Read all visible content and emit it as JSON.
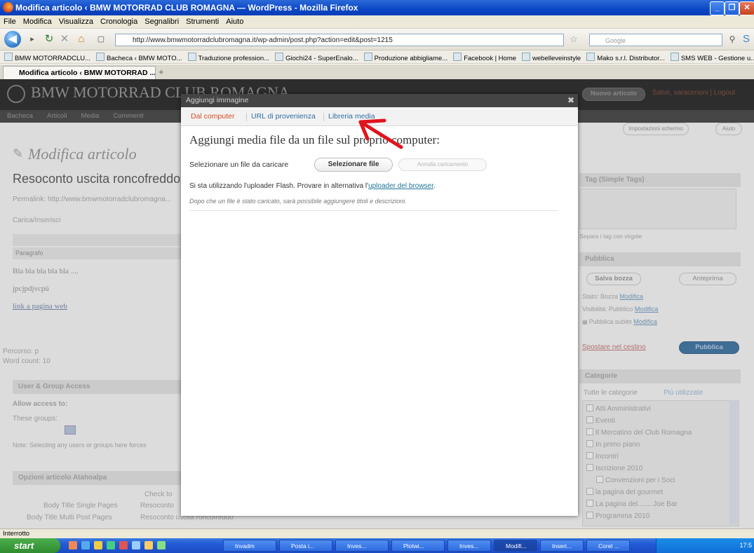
{
  "window": {
    "title": "Modifica articolo ‹ BMW MOTORRAD CLUB ROMAGNA — WordPress - Mozilla Firefox"
  },
  "menu": [
    "File",
    "Modifica",
    "Visualizza",
    "Cronologia",
    "Segnalibri",
    "Strumenti",
    "Aiuto"
  ],
  "nav": {
    "url": "http://www.bmwmotorradclubromagna.it/wp-admin/post.php?action=edit&post=1215",
    "search_placeholder": "Google"
  },
  "bookmarks": [
    "BMW MOTORRADCLU...",
    "Bacheca ‹ BMW MOTO...",
    "Traduzione profession...",
    "Giochi24 - SuperEnalo...",
    "Produzione abbigliame...",
    "Facebook | Home",
    "webelleveinstyle",
    "Mako s.r.l. Distributor...",
    "SMS WEB - Gestione u..."
  ],
  "tab": {
    "label": "Modifica articolo ‹ BMW MOTORRAD ..."
  },
  "wp": {
    "site_name": "BMW MOTORRAD CLUB ROMAGNA",
    "admin_menu": [
      "Bacheca",
      "Articoli",
      "Media",
      "Commenti"
    ],
    "new_post_btn": "Nuovo articolo",
    "howdy": "Salve, saracenoni | Logout",
    "screen_options": "Impostazioni schermo",
    "help": "Aiuto",
    "page_title": "Modifica articolo",
    "post_title": "Resoconto uscita roncofreddo",
    "permalink": "Permalink: http://www.bmwmotorradclubromagna...",
    "upload_insert": "Carica/Inserisci",
    "paragraph": "Paragrafo",
    "content_lines": [
      "Bla bla bla bla bla ....",
      "jpcjpdjvcpù",
      "link a pagina web"
    ],
    "path": "Percorso: p",
    "word_count": "Word count: 10",
    "user_group_access": "User & Group Access",
    "allow_access": "Allow access to:",
    "these_groups": "These groups:",
    "note": "Note: Selecting any users or groups here forces",
    "atahoalpa": "Opzioni articolo Atahoalpa",
    "check_to": "Check to",
    "body_title_single": "Body Title Single Pages",
    "body_title_multi": "Body Title Multi Post Pages",
    "resoconto": "Resoconto",
    "resoconto_multi": "Resoconto uscita roncofreddo",
    "tag_box": "Tag (Simple Tags)",
    "tag_hint": "Separa i tag con virgole",
    "publish_box": "Pubblica",
    "save_draft": "Salva bozza",
    "preview": "Anteprima",
    "status": "Stato: Bozza",
    "visibility": "Visibilità: Pubblico",
    "publish_now": "Pubblica subito",
    "edit_link": "Modifica",
    "trash": "Spostare nel cestino",
    "publish_btn": "Pubblica",
    "categories_box": "Categorie",
    "cat_tabs": [
      "Tutte le categorie",
      "Più utilizzate"
    ],
    "categories": [
      "Atti Amministrativi",
      "Eventi",
      "Il Mercatino del Club Romagna",
      "In primo piano",
      "Incontri",
      "Iscrizione 2010",
      "Convenzioni per i Soci",
      "la pagina del gourmet",
      "La pagina del....... Joe Bar",
      "Programma 2010"
    ]
  },
  "modal": {
    "title": "Aggiungi immagine",
    "tabs": [
      "Dal computer",
      "URL di provenienza",
      "Libreria media"
    ],
    "heading": "Aggiungi media file da un file sul proprio computer:",
    "select_label": "Selezionare un file da caricare",
    "select_btn": "Selezionare file",
    "cancel_btn": "Annulla caricamento",
    "flash_note": "Si sta utilizzando l'uploader Flash. Provare in alternativa l'",
    "flash_link": "uploader del browser",
    "flash_end": ".",
    "after_note": "Dopo che un file è stato caricato, sarà possibile aggiungere titoli e descrizioni."
  },
  "statusbar": {
    "text": "Interrotto"
  },
  "taskbar": {
    "start": "start",
    "tasks": [
      "Invadm",
      "Posta i...",
      "Inves...",
      "Plotwi...",
      "Inves...",
      "Modifi...",
      "Inseri...",
      "Corel ..."
    ],
    "clock": "17:5"
  },
  "colors": {
    "annotation_arrow": "#e0141e",
    "active_tab": "#d54e21",
    "link": "#21759b"
  }
}
